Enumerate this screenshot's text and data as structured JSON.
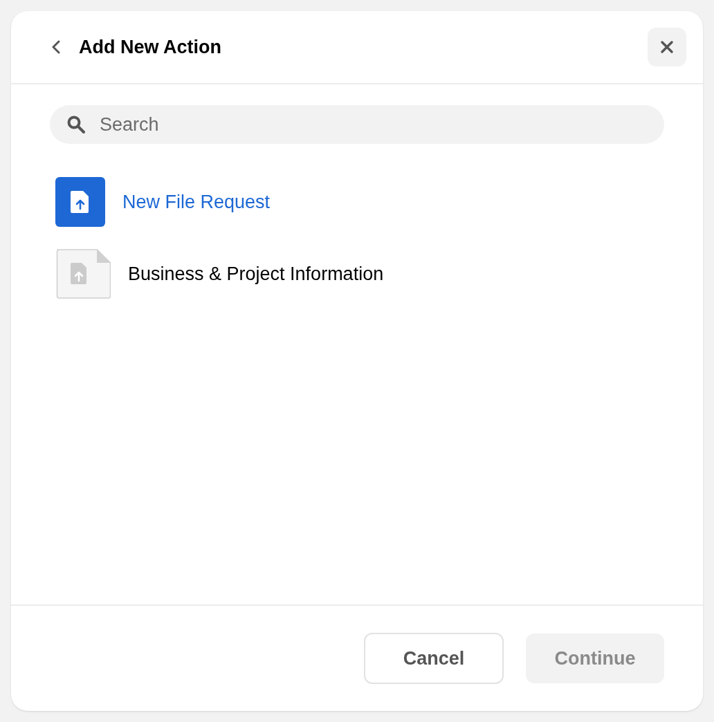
{
  "dialog": {
    "title": "Add New Action"
  },
  "search": {
    "placeholder": "Search"
  },
  "actions": [
    {
      "label": "New File Request",
      "selected": true
    },
    {
      "label": "Business & Project Information",
      "selected": false
    }
  ],
  "buttons": [
    {
      "label": "Cancel",
      "disabled": false
    },
    {
      "label": "Continue",
      "disabled": true
    }
  ]
}
